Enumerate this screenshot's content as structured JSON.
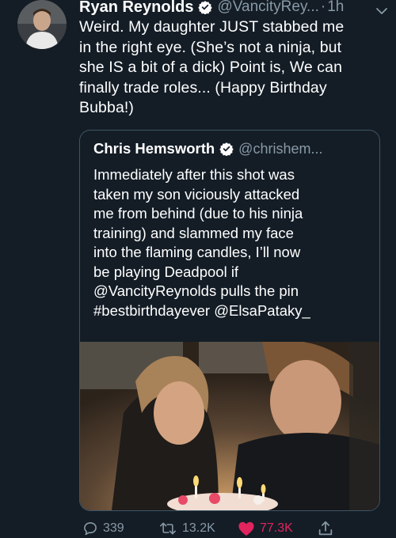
{
  "tweet": {
    "author_name": "Ryan Reynolds",
    "handle": "@VancityRey...",
    "separator": "·",
    "time": "1h",
    "text": "Weird. My daughter JUST stabbed me\nin the right eye. (She’s not a ninja, but\nshe IS a bit of a dick) Point is, We can\nfinally trade roles... (Happy Birthday\nBubba!)"
  },
  "quote": {
    "author_name": "Chris Hemsworth",
    "handle": "@chrishem...",
    "text": "Immediately after this shot was\ntaken my son viciously attacked\nme from behind (due to his ninja\ntraining) and slammed my face\ninto the flaming candles, I’ll now\nbe playing Deadpool if\n@VancityReynolds pulls the pin\n#bestbirthdayever @ElsaPataky_"
  },
  "actions": {
    "replies": "339",
    "retweets": "13.2K",
    "likes": "77.3K"
  },
  "colors": {
    "background": "#141d26",
    "secondary_text": "#8899a6",
    "quote_border": "#3d5466",
    "verified": "#ffffff",
    "like": "#e0245e"
  },
  "icons": [
    "verified-badge-icon",
    "chevron-down-icon",
    "reply-icon",
    "retweet-icon",
    "heart-icon",
    "share-icon"
  ]
}
